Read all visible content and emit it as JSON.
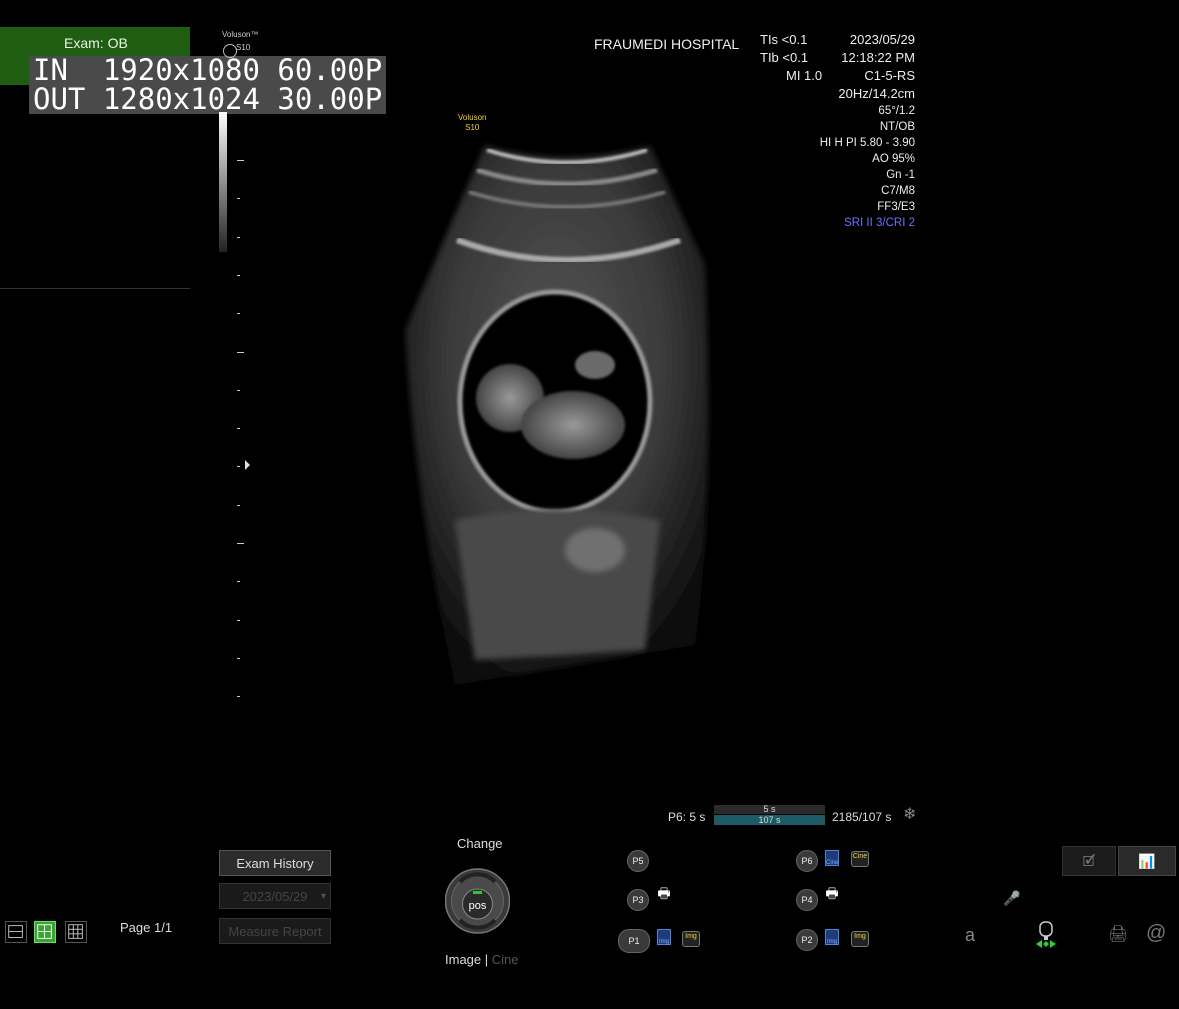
{
  "exam": {
    "label": "Exam:  OB"
  },
  "overlay": {
    "in": "IN  1920x1080 60.00P",
    "out": "OUT 1280x1024 30.00P"
  },
  "logo": {
    "brand": "Voluson™",
    "model": "S10",
    "image_brand": "Voluson",
    "image_model": "S10"
  },
  "header": {
    "hospital": "FRAUMEDI HOSPITAL",
    "tis": "TIs <0.1",
    "tib": "TIb <0.1",
    "mi": "MI  1.0",
    "date": "2023/05/29",
    "time": "12:18:22 PM",
    "probe": "C1-5-RS",
    "freq_depth": "20Hz/14.2cm",
    "params": [
      "65°/1.2",
      "NT/OB",
      "HI H PI 5.80 - 3.90",
      "AO 95%",
      "Gn  -1",
      "C7/M8",
      "FF3/E3"
    ],
    "param_blue": "SRI II 3/CRI 2"
  },
  "cine": {
    "label": "P6:   5 s",
    "top": "5 s",
    "bottom": "107 s",
    "frames": "2185/107 s"
  },
  "side": {
    "history": "Exam History",
    "date": "2023/05/29",
    "report": "Measure Report"
  },
  "page": {
    "label": "Page 1/1"
  },
  "knob": {
    "title": "Change",
    "center": "pos",
    "image": "Image",
    "sep": "|",
    "cine": "Cine"
  },
  "pbuttons": {
    "p1": "P1",
    "p2": "P2",
    "p3": "P3",
    "p4": "P4",
    "p5": "P5",
    "p6": "P6",
    "img": "Img",
    "cine_tag": "Cine"
  },
  "tools": {
    "a": "a",
    "at": "@"
  }
}
